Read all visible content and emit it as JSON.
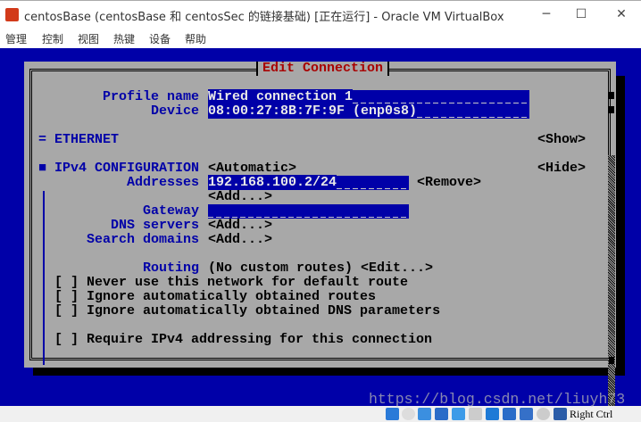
{
  "window": {
    "title": "centosBase (centosBase 和 centosSec 的链接基础) [正在运行] - Oracle VM VirtualBox",
    "minimize": "─",
    "maximize": "☐",
    "close": "✕"
  },
  "menu": [
    "管理",
    "控制",
    "视图",
    "热键",
    "设备",
    "帮助"
  ],
  "dialog": {
    "title": "Edit Connection",
    "profile_label": "Profile name",
    "profile_value": "Wired connection 1",
    "device_label": "Device",
    "device_value": "08:00:27:8B:7F:9F (enp0s8)",
    "ethernet_marker": "=",
    "ethernet": "ETHERNET",
    "show": "<Show>",
    "ipv4_marker": "■",
    "ipv4": "IPv4 CONFIGURATION",
    "ipv4_mode": "<Automatic>",
    "hide": "<Hide>",
    "addresses_label": "Addresses",
    "address_value": "192.168.100.2/24",
    "remove": "<Remove>",
    "add": "<Add...>",
    "gateway_label": "Gateway",
    "gateway_value": "",
    "dns_label": "DNS servers",
    "search_label": "Search domains",
    "routing_label": "Routing",
    "routing_value": "(No custom routes)",
    "edit": "<Edit...>",
    "checks": [
      {
        "box": "[ ]",
        "label": "Never use this network for default route"
      },
      {
        "box": "[ ]",
        "label": "Ignore automatically obtained routes"
      },
      {
        "box": "[ ]",
        "label": "Ignore automatically obtained DNS parameters"
      },
      {
        "box": "[ ]",
        "label": "Require IPv4 addressing for this connection"
      }
    ]
  },
  "watermark": "https://blog.csdn.net/liuyh73",
  "status": {
    "host_key": "Right Ctrl"
  }
}
